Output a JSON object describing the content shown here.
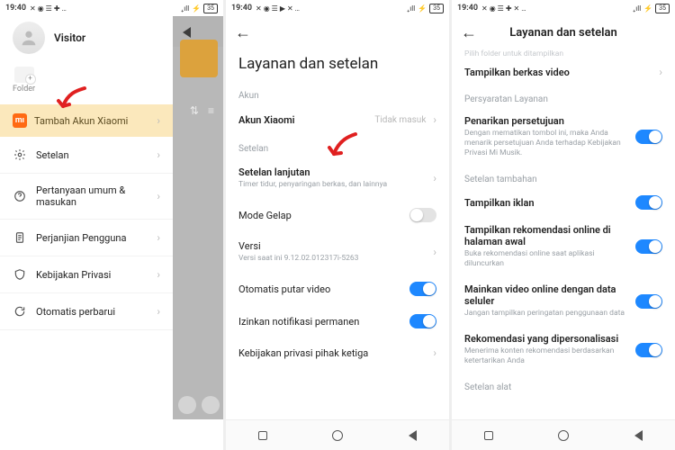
{
  "status": {
    "time": "19:40",
    "icons_left": [
      "✕",
      "◉",
      "☰",
      "✚",
      "✕",
      "…"
    ],
    "right": {
      "signal": "₊ıll ⚡",
      "batt": "35"
    }
  },
  "panel1": {
    "profile_name": "Visitor",
    "folder_label": "Folder",
    "accent": "Tambah Akun Xiaomi",
    "menu": [
      {
        "icon": "gear",
        "label": "Setelan"
      },
      {
        "icon": "help",
        "label": "Pertanyaan umum & masukan"
      },
      {
        "icon": "doc",
        "label": "Perjanjian Pengguna"
      },
      {
        "icon": "shield",
        "label": "Kebijakan Privasi"
      },
      {
        "icon": "refresh",
        "label": "Otomatis perbarui"
      }
    ]
  },
  "panel2": {
    "title": "Layanan dan setelan",
    "sec_akun": "Akun",
    "akun_row": {
      "label": "Akun Xiaomi",
      "value": "Tidak masuk"
    },
    "sec_setelan": "Setelan",
    "rows": [
      {
        "label": "Setelan lanjutan",
        "sub": "Timer tidur, penyaringan berkas, dan lainnya",
        "type": "chev"
      },
      {
        "label": "Mode Gelap",
        "type": "toggle",
        "on": false
      },
      {
        "label": "Versi",
        "sub": "Versi saat ini 9.12.02.012317i-5263",
        "type": "chev"
      },
      {
        "label": "Otomatis putar video",
        "type": "toggle",
        "on": true
      },
      {
        "label": "Izinkan notifikasi permanen",
        "type": "toggle",
        "on": true
      },
      {
        "label": "Kebijakan privasi pihak ketiga",
        "type": "chev"
      }
    ]
  },
  "panel3": {
    "title": "Layanan dan setelan",
    "cut_top": "Pilih folder untuk ditampilkan",
    "row_video": "Tampilkan berkas video",
    "sec_terms": "Persyaratan Layanan",
    "consent": {
      "label": "Penarikan persetujuan",
      "sub": "Dengan mematikan tombol ini, maka Anda menarik persetujuan Anda terhadap Kebijakan Privasi Mi Musik."
    },
    "sec_extra": "Setelan tambahan",
    "rows": [
      {
        "label": "Tampilkan iklan",
        "on": true
      },
      {
        "label": "Tampilkan rekomendasi online di halaman awal",
        "sub": "Buka rekomendasi online saat aplikasi diluncurkan",
        "on": true
      },
      {
        "label": "Mainkan video online dengan data seluler",
        "sub": "Jangan tampilkan peringatan penggunaan data",
        "on": true
      },
      {
        "label": "Rekomendasi yang dipersonalisasi",
        "sub": "Menerima konten rekomendasi berdasarkan ketertarikan Anda",
        "on": true
      }
    ],
    "sec_device": "Setelan alat"
  }
}
